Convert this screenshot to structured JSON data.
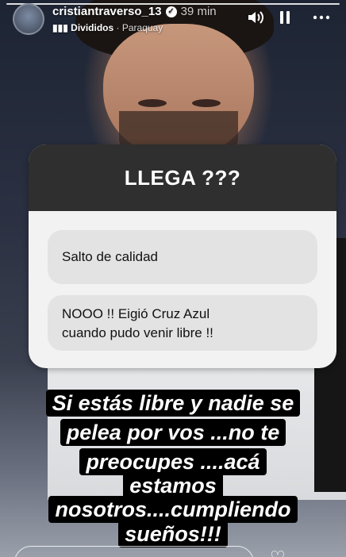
{
  "header": {
    "username": "cristiantraverso_13",
    "time": "39 min",
    "music": {
      "artist": "Divididos",
      "track": "Paraquay"
    }
  },
  "question_card": {
    "question": "LLEGA ???",
    "responses": [
      {
        "line1": "Salto de calidad",
        "line2": ""
      },
      {
        "line1": "NOOO !! Eigió Cruz Azul",
        "line2": "cuando pudo venir libre !!"
      }
    ]
  },
  "caption": {
    "lines": [
      "Si estás libre y nadie se",
      "pelea por vos ...no te",
      "preocupes ....acá",
      "estamos",
      "nosotros....cumpliendo",
      "sueños!!!"
    ]
  },
  "icons": {
    "verified": "verified-badge-icon",
    "sound": "speaker-icon",
    "pause": "pause-icon",
    "more": "more-options-icon",
    "music": "music-bars-icon",
    "like": "heart-icon"
  }
}
